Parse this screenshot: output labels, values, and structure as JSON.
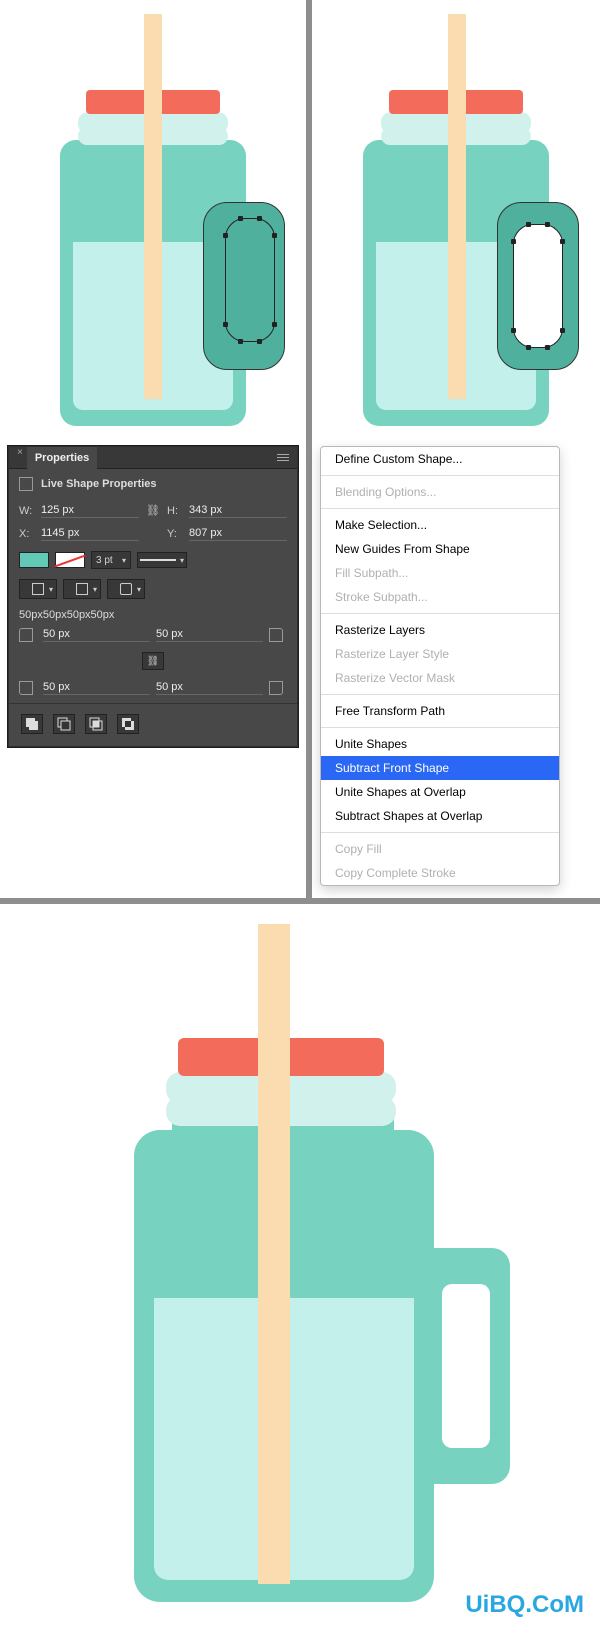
{
  "properties_panel": {
    "tab_label": "Properties",
    "section_title": "Live Shape Properties",
    "w_label": "W:",
    "w_value": "125 px",
    "h_label": "H:",
    "h_value": "343 px",
    "x_label": "X:",
    "x_value": "1145 px",
    "y_label": "Y:",
    "y_value": "807 px",
    "stroke_weight": "3 pt",
    "radius_combined": "50px50px50px50px",
    "radius_tl": "50 px",
    "radius_tr": "50 px",
    "radius_bl": "50 px",
    "radius_br": "50 px",
    "fill_color": "#63c9b7"
  },
  "context_menu": {
    "items": [
      {
        "label": "Define Custom Shape...",
        "disabled": false
      },
      {
        "sep": true
      },
      {
        "label": "Blending Options...",
        "disabled": true
      },
      {
        "sep": true
      },
      {
        "label": "Make Selection...",
        "disabled": false
      },
      {
        "label": "New Guides From Shape",
        "disabled": false
      },
      {
        "label": "Fill Subpath...",
        "disabled": true
      },
      {
        "label": "Stroke Subpath...",
        "disabled": true
      },
      {
        "sep": true
      },
      {
        "label": "Rasterize Layers",
        "disabled": false
      },
      {
        "label": "Rasterize Layer Style",
        "disabled": true
      },
      {
        "label": "Rasterize Vector Mask",
        "disabled": true
      },
      {
        "sep": true
      },
      {
        "label": "Free Transform Path",
        "disabled": false
      },
      {
        "sep": true
      },
      {
        "label": "Unite Shapes",
        "disabled": false
      },
      {
        "label": "Subtract Front Shape",
        "disabled": false,
        "selected": true
      },
      {
        "label": "Unite Shapes at Overlap",
        "disabled": false
      },
      {
        "label": "Subtract Shapes at Overlap",
        "disabled": false
      },
      {
        "sep": true
      },
      {
        "label": "Copy Fill",
        "disabled": true
      },
      {
        "label": "Copy Complete Stroke",
        "disabled": true
      }
    ]
  },
  "watermark": "UiBQ.CoM"
}
